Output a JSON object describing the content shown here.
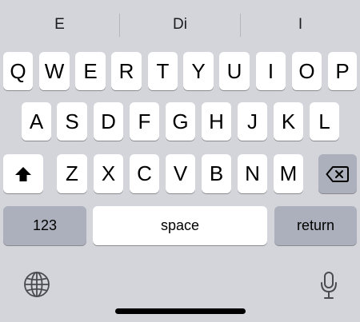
{
  "suggestions": [
    "E",
    "Di",
    "I"
  ],
  "rows": {
    "row1": [
      "Q",
      "W",
      "E",
      "R",
      "T",
      "Y",
      "U",
      "I",
      "O",
      "P"
    ],
    "row2": [
      "A",
      "S",
      "D",
      "F",
      "G",
      "H",
      "J",
      "K",
      "L"
    ],
    "row3": [
      "Z",
      "X",
      "C",
      "V",
      "B",
      "N",
      "M"
    ]
  },
  "bottom_row": {
    "numbers_label": "123",
    "space_label": "space",
    "return_label": "return"
  },
  "icons": {
    "shift": "shift-icon",
    "delete": "delete-icon",
    "globe": "globe-icon",
    "mic": "microphone-icon"
  },
  "colors": {
    "background": "#d3d5db",
    "letter_key": "#ffffff",
    "function_key": "#abb0bc"
  }
}
